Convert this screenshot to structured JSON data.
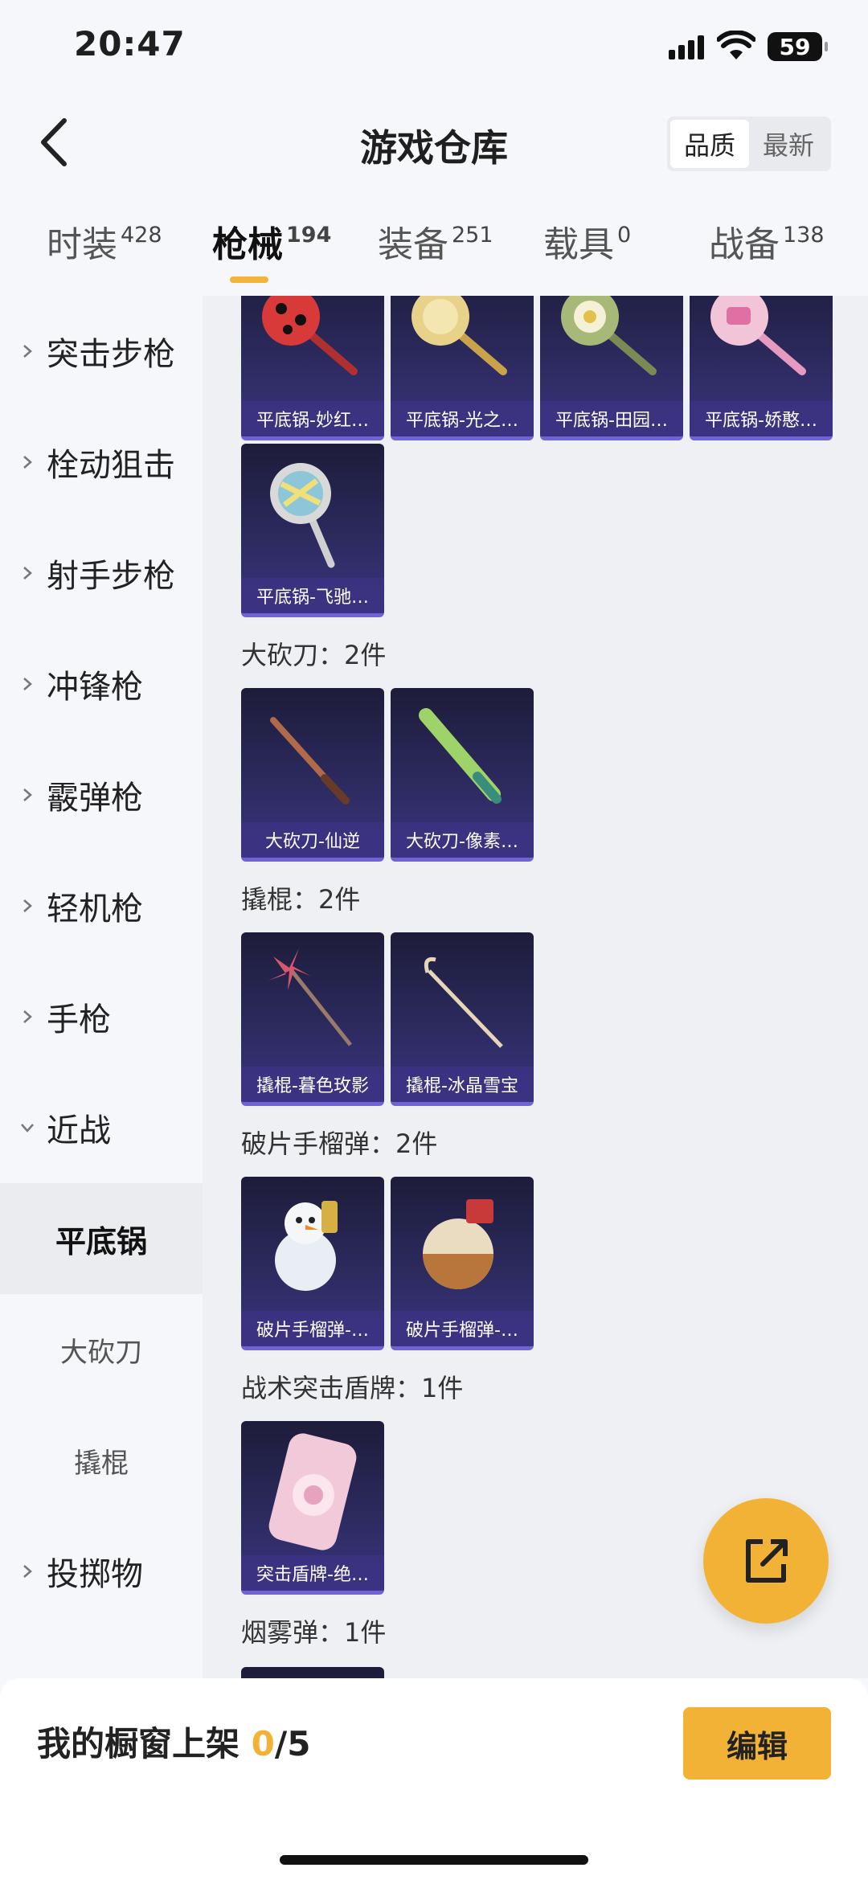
{
  "status": {
    "time": "20:47",
    "battery": "59"
  },
  "header": {
    "title": "游戏仓库",
    "sort_quality": "品质",
    "sort_newest": "最新"
  },
  "tabs": [
    {
      "label": "时装",
      "count": "428"
    },
    {
      "label": "枪械",
      "count": "194"
    },
    {
      "label": "装备",
      "count": "251"
    },
    {
      "label": "载具",
      "count": "0"
    },
    {
      "label": "战备",
      "count": "138"
    }
  ],
  "categories": [
    "突击步枪",
    "栓动狙击",
    "射手步枪",
    "冲锋枪",
    "霰弹枪",
    "轻机枪",
    "手枪",
    "近战"
  ],
  "sub_categories": [
    "平底锅",
    "大砍刀",
    "撬棍"
  ],
  "category_after": "投掷物",
  "sections": {
    "machete": "大砍刀：2件",
    "crowbar": "撬棍：2件",
    "grenade": "破片手榴弹：2件",
    "shield": "战术突击盾牌：1件",
    "smoke": "烟雾弹：1件"
  },
  "items": {
    "pan_row1": [
      "平底锅-妙红…",
      "平底锅-光之…",
      "平底锅-田园…",
      "平底锅-娇憨…"
    ],
    "pan_row2": [
      "平底锅-飞驰…"
    ],
    "machete": [
      "大砍刀-仙逆",
      "大砍刀-像素…"
    ],
    "crowbar": [
      "撬棍-暮色玫影",
      "撬棍-冰晶雪宝"
    ],
    "grenade": [
      "破片手榴弹-…",
      "破片手榴弹-…"
    ],
    "shield": [
      "突击盾牌-绝…"
    ]
  },
  "bottom": {
    "shelf_label": "我的橱窗上架 ",
    "shelf_used": "0",
    "shelf_total": "/5",
    "edit": "编辑"
  },
  "colors": {
    "accent": "#f2b235",
    "card": "#2c2a5e"
  }
}
